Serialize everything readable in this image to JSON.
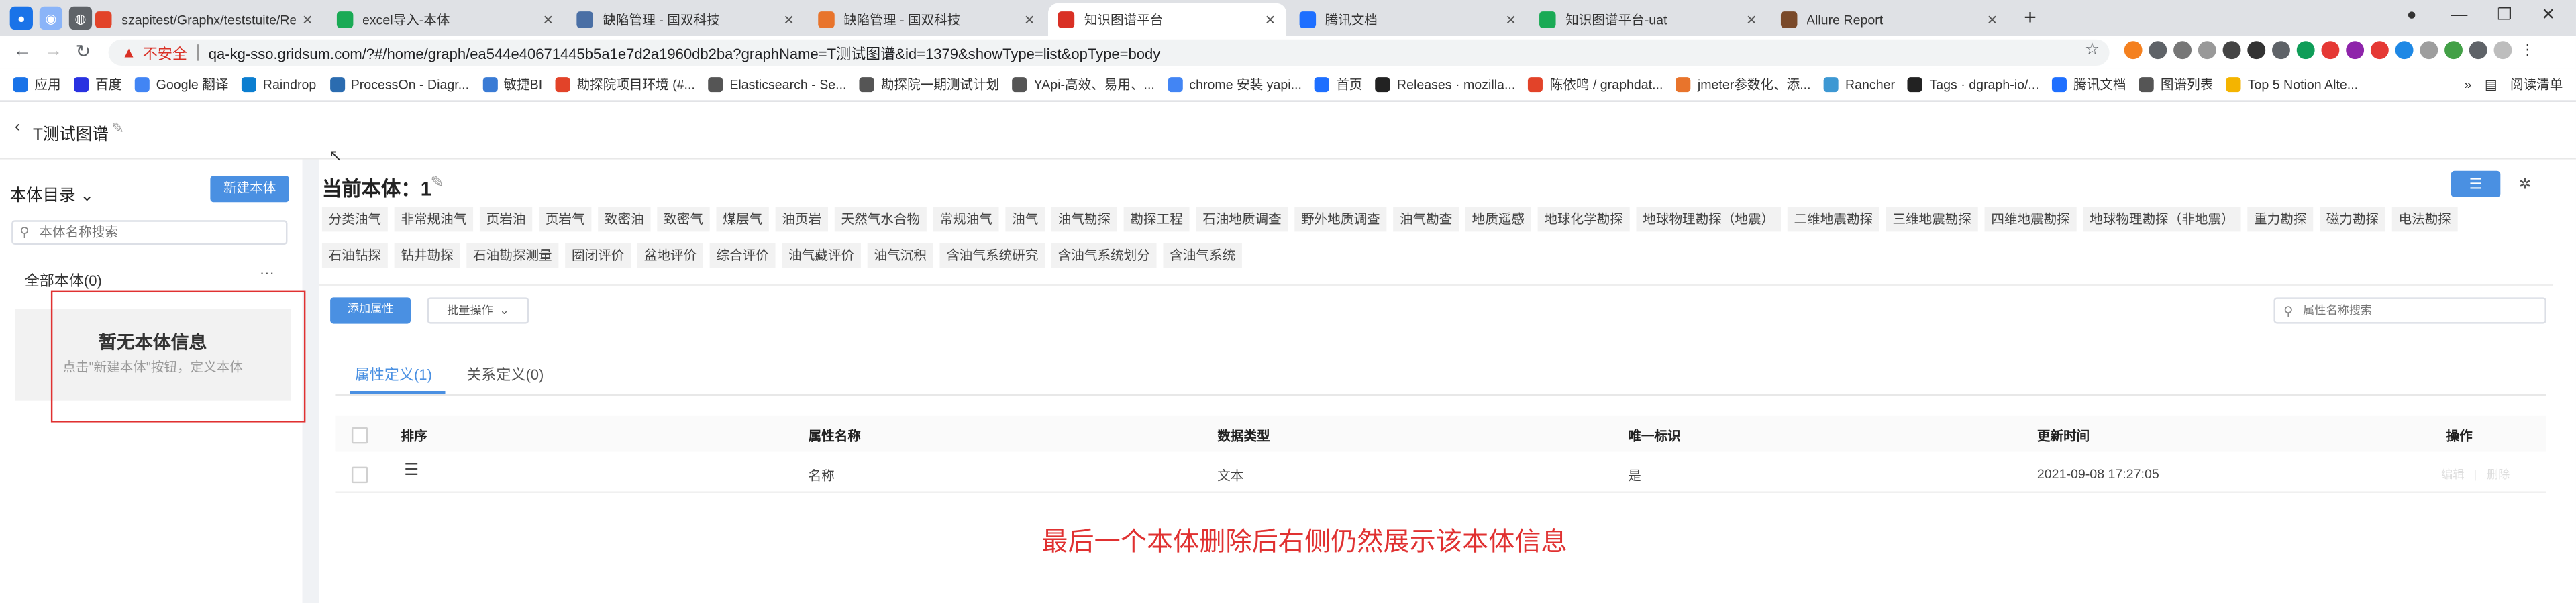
{
  "browser": {
    "tabs": [
      {
        "title": "szapitest/Graphx/teststuite/Re",
        "fav_color": "#e24329"
      },
      {
        "title": "excel导入-本体",
        "fav_color": "#1aaa55"
      },
      {
        "title": "缺陷管理 - 国双科技",
        "fav_color": "#4a6fa5"
      },
      {
        "title": "缺陷管理 - 国双科技",
        "fav_color": "#e8742c"
      },
      {
        "title": "知识图谱平台",
        "fav_color": "#d93025"
      },
      {
        "title": "腾讯文档",
        "fav_color": "#1e6fff"
      },
      {
        "title": "知识图谱平台-uat",
        "fav_color": "#1aaa55"
      },
      {
        "title": "Allure Report",
        "fav_color": "#7a4a2a"
      }
    ],
    "active_tab_index": 4,
    "address": {
      "insecure_label": "不安全",
      "url": "qa-kg-sso.gridsum.com/?#/home/graph/ea544e40671445b5a1e7d2a1960db2ba?graphName=T测试图谱&id=1379&showType=list&opType=body"
    },
    "bookmarks": [
      {
        "label": "应用",
        "color": "#1a73e8"
      },
      {
        "label": "百度",
        "color": "#2932e1"
      },
      {
        "label": "Google 翻译",
        "color": "#4285f4"
      },
      {
        "label": "Raindrop",
        "color": "#0b7ed0"
      },
      {
        "label": "ProcessOn - Diagr...",
        "color": "#2b6cb0"
      },
      {
        "label": "敏捷BI",
        "color": "#3a7bd5"
      },
      {
        "label": "勘探院项目环境 (#...",
        "color": "#e24329"
      },
      {
        "label": "Elasticsearch - Se...",
        "color": "#555555"
      },
      {
        "label": "勘探院一期测试计划",
        "color": "#555555"
      },
      {
        "label": "YApi-高效、易用、...",
        "color": "#555555"
      },
      {
        "label": "chrome 安装 yapi...",
        "color": "#4285f4"
      },
      {
        "label": "首页",
        "color": "#1e6fff"
      },
      {
        "label": "Releases · mozilla...",
        "color": "#222222"
      },
      {
        "label": "陈依鸣 / graphdat...",
        "color": "#e24329"
      },
      {
        "label": "jmeter参数化、添...",
        "color": "#e8742c"
      },
      {
        "label": "Rancher",
        "color": "#3d98d3"
      },
      {
        "label": "Tags · dgraph-io/...",
        "color": "#222222"
      },
      {
        "label": "腾讯文档",
        "color": "#1e6fff"
      },
      {
        "label": "图谱列表",
        "color": "#555555"
      },
      {
        "label": "Top 5 Notion Alte...",
        "color": "#f4b400"
      }
    ],
    "reading_list_label": "阅读清单"
  },
  "header": {
    "graph_title": "T测试图谱"
  },
  "sidebar": {
    "title": "本体目录",
    "new_button": "新建本体",
    "search_placeholder": "本体名称搜索",
    "all_label": "全部本体(0)",
    "more_label": "···",
    "empty_title": "暂无本体信息",
    "empty_hint": "点击\"新建本体\"按钮，定义本体"
  },
  "main": {
    "current_label": "当前本体：",
    "current_value": "1",
    "tags": [
      "分类油气",
      "非常规油气",
      "页岩油",
      "页岩气",
      "致密油",
      "致密气",
      "煤层气",
      "油页岩",
      "天然气水合物",
      "常规油气",
      "油气",
      "油气勘探",
      "勘探工程",
      "石油地质调查",
      "野外地质调查",
      "油气勘查",
      "地质遥感",
      "地球化学勘探",
      "地球物理勘探（地震）",
      "二维地震勘探",
      "三维地震勘探",
      "四维地震勘探",
      "地球物理勘探（非地震）",
      "重力勘探",
      "磁力勘探",
      "电法勘探",
      "石油钻探",
      "钻井勘探",
      "石油勘探测量",
      "圈闭评价",
      "盆地评价",
      "综合评价",
      "油气藏评价",
      "油气沉积",
      "含油气系统研究",
      "含油气系统划分",
      "含油气系统"
    ],
    "add_attr_button": "添加属性",
    "batch_button": "批量操作",
    "attr_search_placeholder": "属性名称搜索",
    "subtabs": [
      "属性定义(1)",
      "关系定义(0)"
    ],
    "columns": [
      "排序",
      "属性名称",
      "数据类型",
      "唯一标识",
      "更新时间",
      "操作"
    ],
    "rows": [
      {
        "name": "名称",
        "type": "文本",
        "unique": "是",
        "updated": "2021-09-08 17:27:05",
        "op_edit": "编辑",
        "op_delete": "删除"
      }
    ]
  },
  "annotation": "最后一个本体删除后右侧仍然展示该本体信息"
}
